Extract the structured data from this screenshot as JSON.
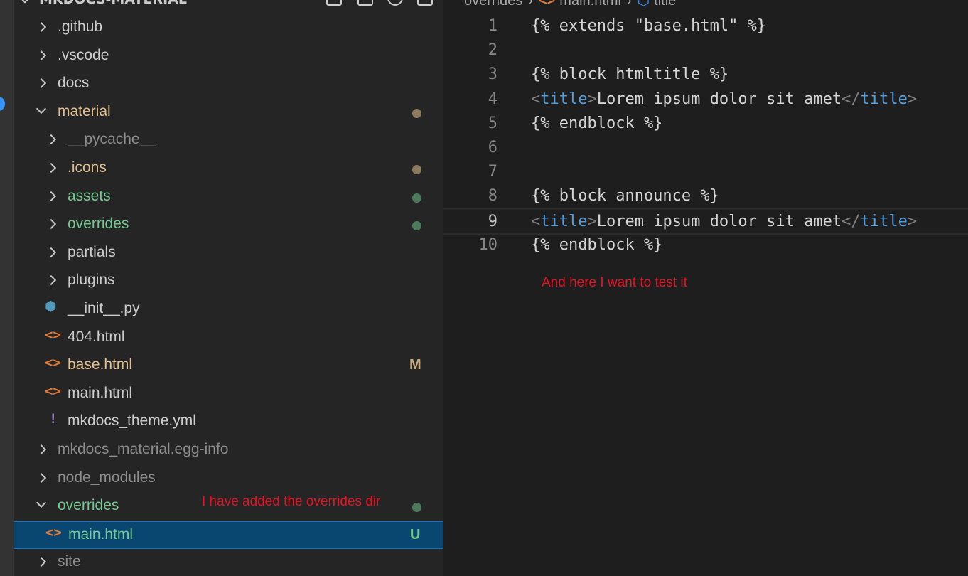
{
  "explorer": {
    "title": "MKDOCS-MATERIAL",
    "items": [
      {
        "label": ".github",
        "type": "folder",
        "level": 0,
        "expanded": false,
        "color": "#cccccc"
      },
      {
        "label": ".vscode",
        "type": "folder",
        "level": 0,
        "expanded": false,
        "color": "#cccccc"
      },
      {
        "label": "docs",
        "type": "folder",
        "level": 0,
        "expanded": false,
        "color": "#cccccc"
      },
      {
        "label": "material",
        "type": "folder",
        "level": 0,
        "expanded": true,
        "color": "#e2c08d",
        "badge_dot": "#8c7b5f"
      },
      {
        "label": "__pycache__",
        "type": "folder",
        "level": 1,
        "expanded": false,
        "color": "#8c8c8c"
      },
      {
        "label": ".icons",
        "type": "folder",
        "level": 1,
        "expanded": false,
        "color": "#e2c08d",
        "badge_dot": "#8c7b5f"
      },
      {
        "label": "assets",
        "type": "folder",
        "level": 1,
        "expanded": false,
        "color": "#73c991",
        "badge_dot": "#4e7a5c"
      },
      {
        "label": "overrides",
        "type": "folder",
        "level": 1,
        "expanded": false,
        "color": "#73c991",
        "badge_dot": "#4e7a5c"
      },
      {
        "label": "partials",
        "type": "folder",
        "level": 1,
        "expanded": false,
        "color": "#cccccc"
      },
      {
        "label": "plugins",
        "type": "folder",
        "level": 1,
        "expanded": false,
        "color": "#cccccc"
      },
      {
        "label": "__init__.py",
        "type": "file",
        "icon": "python-icon",
        "level": 1,
        "color": "#cccccc"
      },
      {
        "label": "404.html",
        "type": "file",
        "icon": "html-icon",
        "level": 1,
        "color": "#cccccc"
      },
      {
        "label": "base.html",
        "type": "file",
        "icon": "html-icon",
        "level": 1,
        "color": "#e2c08d",
        "badge_letter": "M",
        "badge_color": "#c8a97e"
      },
      {
        "label": "main.html",
        "type": "file",
        "icon": "html-icon",
        "level": 1,
        "color": "#cccccc"
      },
      {
        "label": "mkdocs_theme.yml",
        "type": "file",
        "icon": "yaml-icon",
        "level": 1,
        "color": "#cccccc"
      },
      {
        "label": "mkdocs_material.egg-info",
        "type": "folder",
        "level": 0,
        "expanded": false,
        "color": "#8c8c8c"
      },
      {
        "label": "node_modules",
        "type": "folder",
        "level": 0,
        "expanded": false,
        "color": "#8c8c8c"
      },
      {
        "label": "overrides",
        "type": "folder",
        "level": 0,
        "expanded": true,
        "color": "#73c991",
        "badge_dot": "#4e7a5c"
      },
      {
        "label": "main.html",
        "type": "file",
        "icon": "html-icon",
        "level": 1,
        "color": "#73c991",
        "badge_letter": "U",
        "badge_color": "#73c991",
        "selected": true
      },
      {
        "label": "site",
        "type": "folder",
        "level": 0,
        "expanded": false,
        "color": "#8c8c8c"
      }
    ],
    "annotation": "I have added the overrides dir"
  },
  "editor": {
    "breadcrumb": {
      "folder": "overrides",
      "file": "main.html",
      "symbol": "title"
    },
    "current_line": 9,
    "lines": [
      {
        "num": "1",
        "parts": [
          {
            "t": "{% extends \"base.html\" %}",
            "c": "text"
          }
        ]
      },
      {
        "num": "2",
        "parts": []
      },
      {
        "num": "3",
        "parts": [
          {
            "t": "{% block htmltitle %}",
            "c": "text"
          }
        ]
      },
      {
        "num": "4",
        "parts": [
          {
            "t": "<",
            "c": "bracket"
          },
          {
            "t": "title",
            "c": "tag"
          },
          {
            "t": ">",
            "c": "bracket"
          },
          {
            "t": "Lorem ipsum dolor sit amet",
            "c": "text"
          },
          {
            "t": "</",
            "c": "bracket"
          },
          {
            "t": "title",
            "c": "tag"
          },
          {
            "t": ">",
            "c": "bracket"
          }
        ]
      },
      {
        "num": "5",
        "parts": [
          {
            "t": "{% endblock %}",
            "c": "text"
          }
        ]
      },
      {
        "num": "6",
        "parts": []
      },
      {
        "num": "7",
        "parts": []
      },
      {
        "num": "8",
        "parts": [
          {
            "t": "{% block announce %}",
            "c": "text"
          }
        ]
      },
      {
        "num": "9",
        "parts": [
          {
            "t": "<",
            "c": "bracket"
          },
          {
            "t": "title",
            "c": "tag"
          },
          {
            "t": ">",
            "c": "bracket"
          },
          {
            "t": "Lorem ipsum dolor sit amet",
            "c": "text"
          },
          {
            "t": "</",
            "c": "bracket"
          },
          {
            "t": "title",
            "c": "tag"
          },
          {
            "t": ">",
            "c": "bracket"
          }
        ]
      },
      {
        "num": "10",
        "parts": [
          {
            "t": "{% endblock %}",
            "c": "text"
          }
        ]
      }
    ],
    "annotation": "And here I want to test it"
  }
}
